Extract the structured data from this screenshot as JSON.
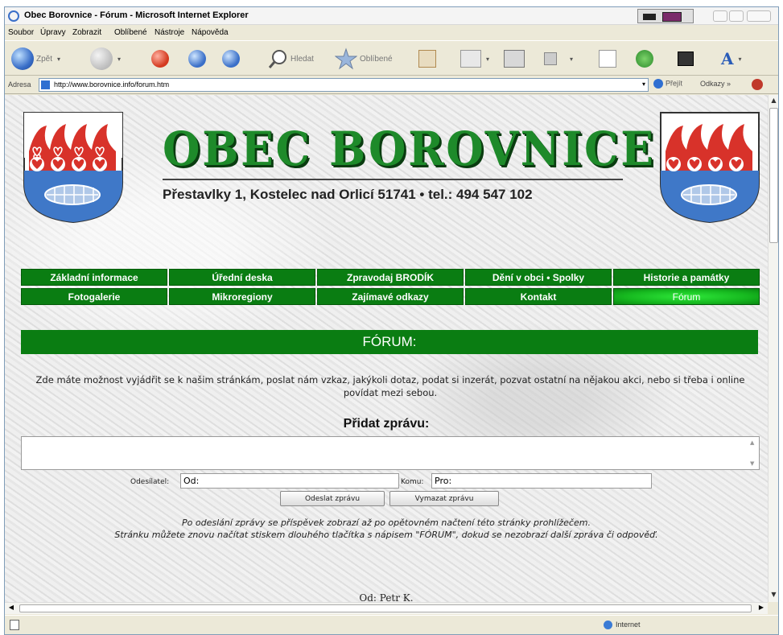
{
  "window": {
    "title": "Obec Borovnice - Fórum - Microsoft Internet Explorer"
  },
  "menu": [
    "Soubor",
    "Úpravy",
    "Zobrazit",
    "Oblíbené",
    "Nástroje",
    "Nápověda"
  ],
  "toolbar": {
    "back_label": "Zpět",
    "search_label": "Hledat",
    "favorites_label": "Oblíbené"
  },
  "address": {
    "label": "Adresa",
    "url": "http://www.borovnice.info/forum.htm",
    "go_label": "Přejít",
    "links_label": "Odkazy"
  },
  "page": {
    "site_title": "OBEC BOROVNICE",
    "site_address": "Přestavlky 1, Kostelec nad Orlicí 51741 • tel.: 494 547 102",
    "nav_row1": [
      "Základní informace",
      "Úřední deska",
      "Zpravodaj BRODÍK",
      "Dění v obci • Spolky",
      "Historie a památky"
    ],
    "nav_row2": [
      "Fotogalerie",
      "Mikroregiony",
      "Zajímavé odkazy",
      "Kontakt",
      "Fórum"
    ],
    "active_nav": "Fórum",
    "banner": "FÓRUM:",
    "intro": "Zde máte možnost vyjádřit se k našim stránkám, poslat nám vzkaz, jakýkoli dotaz, podat si inzerát, pozvat ostatní na nějakou akci, nebo si třeba i online povídat mezi sebou.",
    "add_heading": "Přidat zprávu:",
    "message_value": "",
    "from_label": "Odesílatel:",
    "from_value": "Od:",
    "to_label": "Komu:",
    "to_value": "Pro:",
    "send_button": "Odeslat zprávu",
    "clear_button": "Vymazat zprávu",
    "note_line1": "Po odeslání zprávy se příspěvek zobrazí až po opětovném načtení této stránky prohlížečem.",
    "note_line2": "Stránku můžete znovu načítat stiskem dlouhého tlačítka s nápisem \"FÓRUM\", dokud se nezobrazí další zpráva či odpověď.",
    "post_from": "Od: Petr K."
  },
  "status": {
    "zone": "Internet"
  },
  "colors": {
    "nav_green": "#0a7d12",
    "title_green": "#1e8a2a",
    "active_green": "#2ee83a"
  }
}
